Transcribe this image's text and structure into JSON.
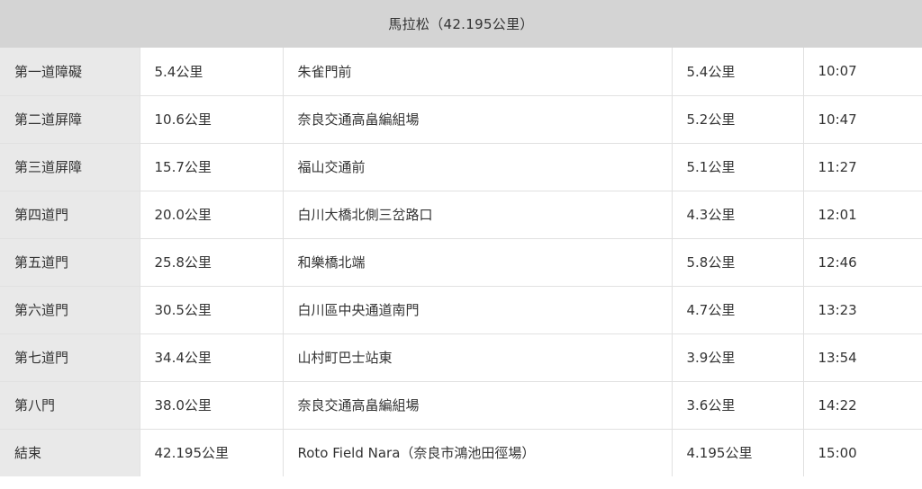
{
  "header": {
    "title": "馬拉松（42.195公里）"
  },
  "rows": [
    {
      "label": "第一道障礙",
      "distance": "5.4公里",
      "location": "朱雀門前",
      "segment": "5.4公里",
      "time": "10:07"
    },
    {
      "label": "第二道屏障",
      "distance": "10.6公里",
      "location": "奈良交通高畠編組場",
      "segment": "5.2公里",
      "time": "10:47"
    },
    {
      "label": "第三道屏障",
      "distance": "15.7公里",
      "location": "福山交通前",
      "segment": "5.1公里",
      "time": "11:27"
    },
    {
      "label": "第四道門",
      "distance": "20.0公里",
      "location": "白川大橋北側三岔路口",
      "segment": "4.3公里",
      "time": "12:01"
    },
    {
      "label": "第五道門",
      "distance": "25.8公里",
      "location": "和樂橋北端",
      "segment": "5.8公里",
      "time": "12:46"
    },
    {
      "label": "第六道門",
      "distance": "30.5公里",
      "location": "白川區中央通道南門",
      "segment": "4.7公里",
      "time": "13:23"
    },
    {
      "label": "第七道門",
      "distance": "34.4公里",
      "location": "山村町巴士站東",
      "segment": "3.9公里",
      "time": "13:54"
    },
    {
      "label": "第八門",
      "distance": "38.0公里",
      "location": "奈良交通高畠編組場",
      "segment": "3.6公里",
      "time": "14:22"
    },
    {
      "label": "結束",
      "distance": "42.195公里",
      "location": "Roto Field Nara（奈良市鴻池田徑場）",
      "segment": "4.195公里",
      "time": "15:00"
    }
  ]
}
